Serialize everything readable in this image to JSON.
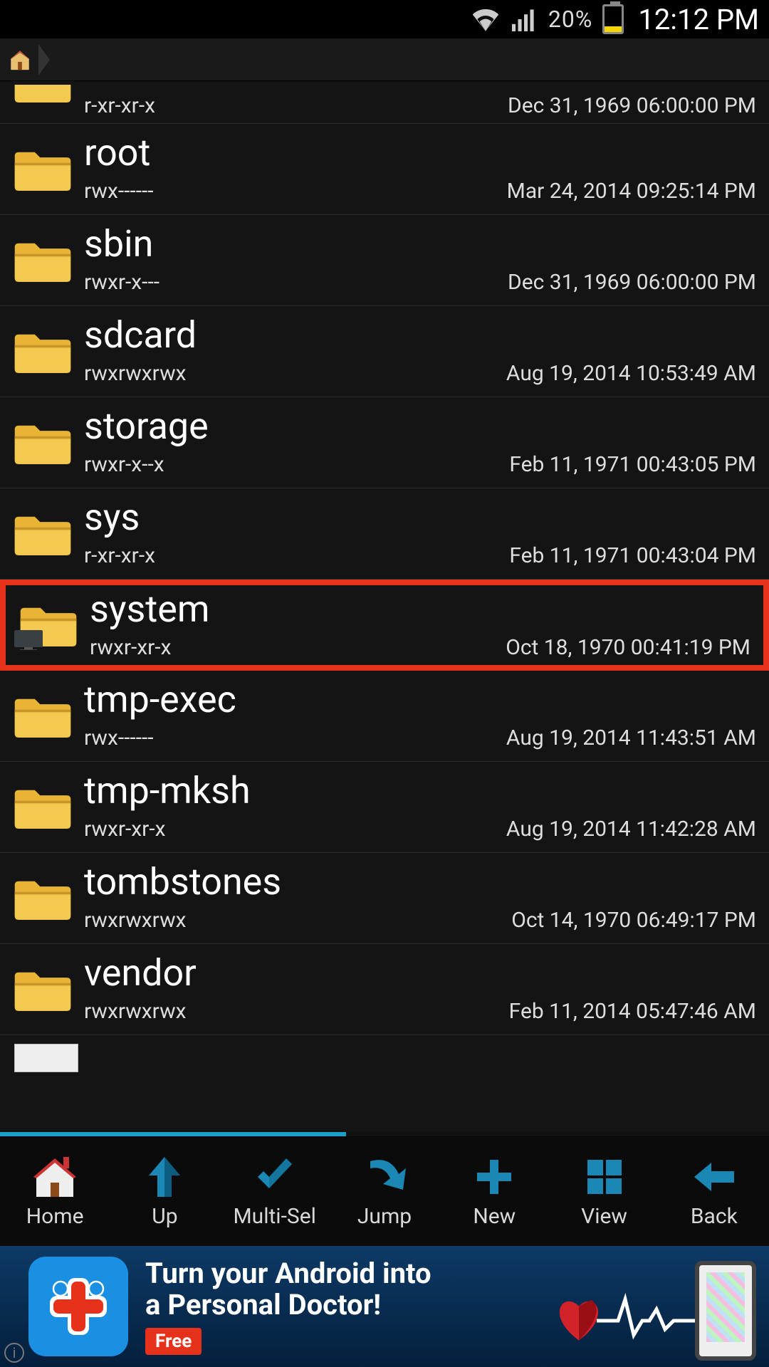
{
  "status": {
    "battery_pct": "20%",
    "clock": "12:12 PM"
  },
  "files": [
    {
      "name": "",
      "perms": "r-xr-xr-x",
      "date": "Dec 31, 1969 06:00:00 PM",
      "short": true,
      "hl": false
    },
    {
      "name": "root",
      "perms": "rwx------",
      "date": "Mar 24, 2014 09:25:14 PM",
      "short": false,
      "hl": false
    },
    {
      "name": "sbin",
      "perms": "rwxr-x---",
      "date": "Dec 31, 1969 06:00:00 PM",
      "short": false,
      "hl": false
    },
    {
      "name": "sdcard",
      "perms": "rwxrwxrwx",
      "date": "Aug 19, 2014 10:53:49 AM",
      "short": false,
      "hl": false
    },
    {
      "name": "storage",
      "perms": "rwxr-x--x",
      "date": "Feb 11, 1971 00:43:05 PM",
      "short": false,
      "hl": false
    },
    {
      "name": "sys",
      "perms": "r-xr-xr-x",
      "date": "Feb 11, 1971 00:43:04 PM",
      "short": false,
      "hl": false
    },
    {
      "name": "system",
      "perms": "rwxr-xr-x",
      "date": "Oct 18, 1970 00:41:19 PM",
      "short": false,
      "hl": true
    },
    {
      "name": "tmp-exec",
      "perms": "rwx------",
      "date": "Aug 19, 2014 11:43:51 AM",
      "short": false,
      "hl": false
    },
    {
      "name": "tmp-mksh",
      "perms": "rwxr-xr-x",
      "date": "Aug 19, 2014 11:42:28 AM",
      "short": false,
      "hl": false
    },
    {
      "name": "tombstones",
      "perms": "rwxrwxrwx",
      "date": "Oct 14, 1970 06:49:17 PM",
      "short": false,
      "hl": false
    },
    {
      "name": "vendor",
      "perms": "rwxrwxrwx",
      "date": "Feb 11, 2014 05:47:46 AM",
      "short": false,
      "hl": false
    }
  ],
  "toolbar": [
    {
      "key": "home",
      "label": "Home"
    },
    {
      "key": "up",
      "label": "Up"
    },
    {
      "key": "multisel",
      "label": "Multi-Sel"
    },
    {
      "key": "jump",
      "label": "Jump"
    },
    {
      "key": "new",
      "label": "New"
    },
    {
      "key": "view",
      "label": "View"
    },
    {
      "key": "back",
      "label": "Back"
    }
  ],
  "ad": {
    "line1": "Turn your Android into",
    "line2": "a Personal Doctor!",
    "badge": "Free"
  }
}
